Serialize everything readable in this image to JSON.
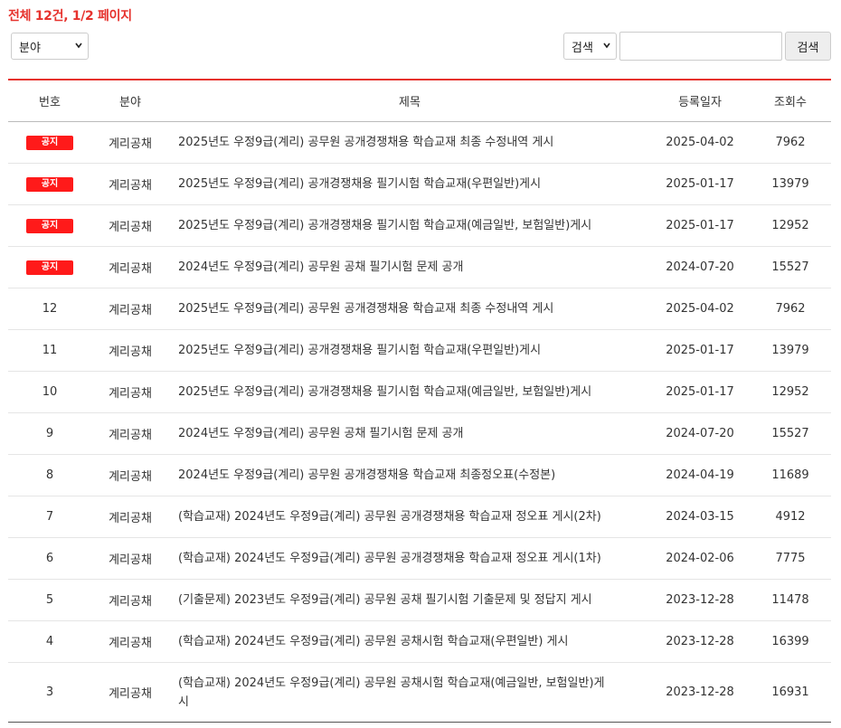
{
  "summary": "전체 12건, 1/2 페이지",
  "filters": {
    "category_selected": "분야",
    "search_type_selected": "검색",
    "search_value": "",
    "search_button": "검색"
  },
  "table": {
    "headers": [
      "번호",
      "분야",
      "제목",
      "등록일자",
      "조회수"
    ],
    "rows": [
      {
        "num": "공지",
        "notice": true,
        "category": "계리공채",
        "title": "2025년도 우정9급(계리) 공무원 공개경쟁채용 학습교재 최종 수정내역 게시",
        "date": "2025-04-02",
        "views": "7962"
      },
      {
        "num": "공지",
        "notice": true,
        "category": "계리공채",
        "title": "2025년도 우정9급(계리) 공개경쟁채용 필기시험 학습교재(우편일반)게시",
        "date": "2025-01-17",
        "views": "13979"
      },
      {
        "num": "공지",
        "notice": true,
        "category": "계리공채",
        "title": "2025년도 우정9급(계리) 공개경쟁채용 필기시험 학습교재(예금일반, 보험일반)게시",
        "date": "2025-01-17",
        "views": "12952"
      },
      {
        "num": "공지",
        "notice": true,
        "category": "계리공채",
        "title": "2024년도 우정9급(계리) 공무원 공채 필기시험 문제 공개",
        "date": "2024-07-20",
        "views": "15527"
      },
      {
        "num": "12",
        "notice": false,
        "category": "계리공채",
        "title": "2025년도 우정9급(계리) 공무원 공개경쟁채용 학습교재 최종 수정내역 게시",
        "date": "2025-04-02",
        "views": "7962"
      },
      {
        "num": "11",
        "notice": false,
        "category": "계리공채",
        "title": "2025년도 우정9급(계리) 공개경쟁채용 필기시험 학습교재(우편일반)게시",
        "date": "2025-01-17",
        "views": "13979"
      },
      {
        "num": "10",
        "notice": false,
        "category": "계리공채",
        "title": "2025년도 우정9급(계리) 공개경쟁채용 필기시험 학습교재(예금일반, 보험일반)게시",
        "date": "2025-01-17",
        "views": "12952"
      },
      {
        "num": "9",
        "notice": false,
        "category": "계리공채",
        "title": "2024년도 우정9급(계리) 공무원 공채 필기시험 문제 공개",
        "date": "2024-07-20",
        "views": "15527"
      },
      {
        "num": "8",
        "notice": false,
        "category": "계리공채",
        "title": "2024년도 우정9급(계리) 공무원 공개경쟁채용 학습교재 최종정오표(수정본)",
        "date": "2024-04-19",
        "views": "11689"
      },
      {
        "num": "7",
        "notice": false,
        "category": "계리공채",
        "title": "(학습교재) 2024년도 우정9급(계리) 공무원 공개경쟁채용 학습교재 정오표 게시(2차)",
        "date": "2024-03-15",
        "views": "4912"
      },
      {
        "num": "6",
        "notice": false,
        "category": "계리공채",
        "title": "(학습교재) 2024년도 우정9급(계리) 공무원 공개경쟁채용 학습교재 정오표 게시(1차)",
        "date": "2024-02-06",
        "views": "7775"
      },
      {
        "num": "5",
        "notice": false,
        "category": "계리공채",
        "title": "(기출문제) 2023년도 우정9급(계리) 공무원 공채 필기시험 기출문제 및 정답지 게시",
        "date": "2023-12-28",
        "views": "11478"
      },
      {
        "num": "4",
        "notice": false,
        "category": "계리공채",
        "title": "(학습교재) 2024년도 우정9급(계리) 공무원 공채시험 학습교재(우편일반) 게시",
        "date": "2023-12-28",
        "views": "16399"
      },
      {
        "num": "3",
        "notice": false,
        "category": "계리공채",
        "title": "(학습교재) 2024년도 우정9급(계리) 공무원 공채시험 학습교재(예금일반, 보험일반)게시",
        "date": "2023-12-28",
        "views": "16931"
      }
    ]
  }
}
